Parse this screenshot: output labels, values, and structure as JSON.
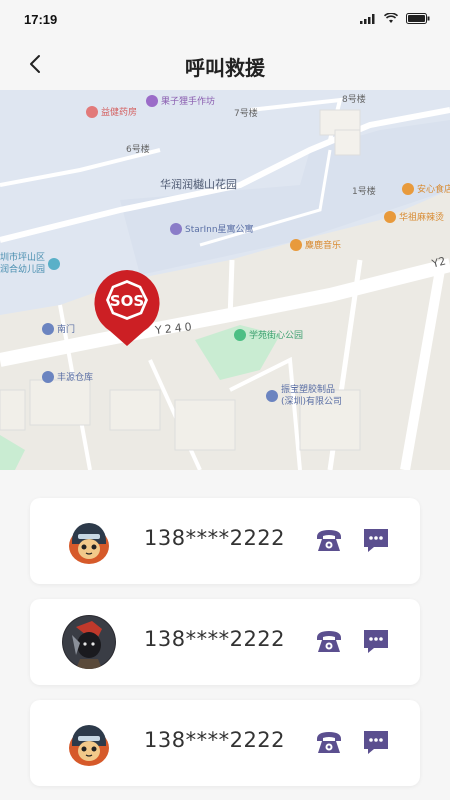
{
  "status_bar": {
    "time": "17:19"
  },
  "header": {
    "title": "呼叫救援"
  },
  "map": {
    "labels": {
      "building8": "8号楼",
      "building7": "7号楼",
      "building6": "6号楼",
      "building1": "1号楼",
      "garden": "华润润樾山花园",
      "hotel": "StarInn星寓公寓",
      "road": "Y240",
      "road_right": "Y2",
      "pharmacy": "益健药房",
      "workshop": "果子狸手作坊",
      "anxin": "安心食店",
      "huazu": "华祖麻辣烫",
      "music": "麋鹿音乐",
      "school_line1": "圳市坪山区",
      "school_line2": "润合幼儿园",
      "south_gate": "南门",
      "park": "学苑街心公园",
      "warehouse": "丰源仓库",
      "factory_line1": "振宝塑胶制品",
      "factory_line2": "(深圳)有限公司"
    },
    "sos_label": "SOS",
    "colors": {
      "sos": "#cc1f24",
      "water": "#dfe6f1",
      "green": "#c9ecd2"
    }
  },
  "contacts": [
    {
      "phone": "138****2222",
      "avatar": "cat-helmet"
    },
    {
      "phone": "138****2222",
      "avatar": "dark-warrior"
    },
    {
      "phone": "138****2222",
      "avatar": "cat-helmet"
    }
  ],
  "accent": "#5b4f8f"
}
